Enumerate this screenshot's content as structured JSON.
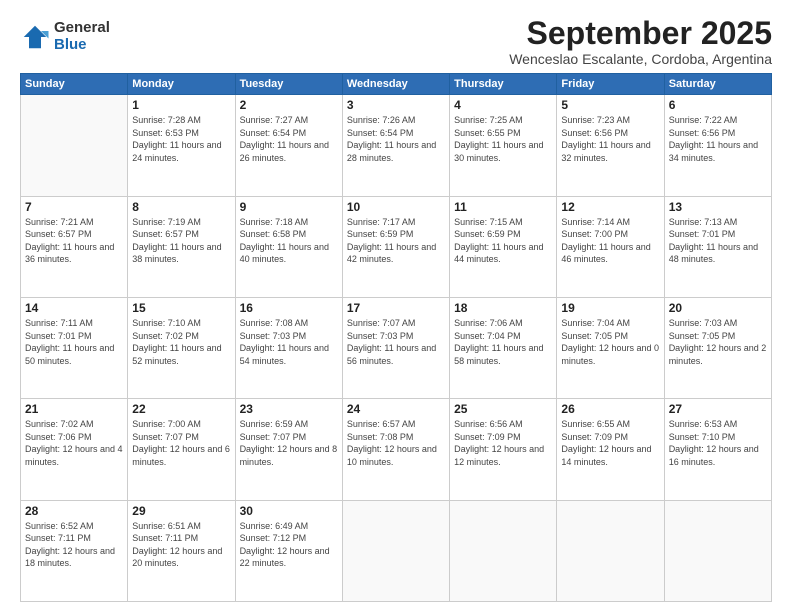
{
  "logo": {
    "general": "General",
    "blue": "Blue"
  },
  "header": {
    "month": "September 2025",
    "location": "Wenceslao Escalante, Cordoba, Argentina"
  },
  "weekdays": [
    "Sunday",
    "Monday",
    "Tuesday",
    "Wednesday",
    "Thursday",
    "Friday",
    "Saturday"
  ],
  "weeks": [
    [
      {
        "day": null,
        "sunrise": null,
        "sunset": null,
        "daylight": null
      },
      {
        "day": "1",
        "sunrise": "7:28 AM",
        "sunset": "6:53 PM",
        "daylight": "11 hours and 24 minutes."
      },
      {
        "day": "2",
        "sunrise": "7:27 AM",
        "sunset": "6:54 PM",
        "daylight": "11 hours and 26 minutes."
      },
      {
        "day": "3",
        "sunrise": "7:26 AM",
        "sunset": "6:54 PM",
        "daylight": "11 hours and 28 minutes."
      },
      {
        "day": "4",
        "sunrise": "7:25 AM",
        "sunset": "6:55 PM",
        "daylight": "11 hours and 30 minutes."
      },
      {
        "day": "5",
        "sunrise": "7:23 AM",
        "sunset": "6:56 PM",
        "daylight": "11 hours and 32 minutes."
      },
      {
        "day": "6",
        "sunrise": "7:22 AM",
        "sunset": "6:56 PM",
        "daylight": "11 hours and 34 minutes."
      }
    ],
    [
      {
        "day": "7",
        "sunrise": "7:21 AM",
        "sunset": "6:57 PM",
        "daylight": "11 hours and 36 minutes."
      },
      {
        "day": "8",
        "sunrise": "7:19 AM",
        "sunset": "6:57 PM",
        "daylight": "11 hours and 38 minutes."
      },
      {
        "day": "9",
        "sunrise": "7:18 AM",
        "sunset": "6:58 PM",
        "daylight": "11 hours and 40 minutes."
      },
      {
        "day": "10",
        "sunrise": "7:17 AM",
        "sunset": "6:59 PM",
        "daylight": "11 hours and 42 minutes."
      },
      {
        "day": "11",
        "sunrise": "7:15 AM",
        "sunset": "6:59 PM",
        "daylight": "11 hours and 44 minutes."
      },
      {
        "day": "12",
        "sunrise": "7:14 AM",
        "sunset": "7:00 PM",
        "daylight": "11 hours and 46 minutes."
      },
      {
        "day": "13",
        "sunrise": "7:13 AM",
        "sunset": "7:01 PM",
        "daylight": "11 hours and 48 minutes."
      }
    ],
    [
      {
        "day": "14",
        "sunrise": "7:11 AM",
        "sunset": "7:01 PM",
        "daylight": "11 hours and 50 minutes."
      },
      {
        "day": "15",
        "sunrise": "7:10 AM",
        "sunset": "7:02 PM",
        "daylight": "11 hours and 52 minutes."
      },
      {
        "day": "16",
        "sunrise": "7:08 AM",
        "sunset": "7:03 PM",
        "daylight": "11 hours and 54 minutes."
      },
      {
        "day": "17",
        "sunrise": "7:07 AM",
        "sunset": "7:03 PM",
        "daylight": "11 hours and 56 minutes."
      },
      {
        "day": "18",
        "sunrise": "7:06 AM",
        "sunset": "7:04 PM",
        "daylight": "11 hours and 58 minutes."
      },
      {
        "day": "19",
        "sunrise": "7:04 AM",
        "sunset": "7:05 PM",
        "daylight": "12 hours and 0 minutes."
      },
      {
        "day": "20",
        "sunrise": "7:03 AM",
        "sunset": "7:05 PM",
        "daylight": "12 hours and 2 minutes."
      }
    ],
    [
      {
        "day": "21",
        "sunrise": "7:02 AM",
        "sunset": "7:06 PM",
        "daylight": "12 hours and 4 minutes."
      },
      {
        "day": "22",
        "sunrise": "7:00 AM",
        "sunset": "7:07 PM",
        "daylight": "12 hours and 6 minutes."
      },
      {
        "day": "23",
        "sunrise": "6:59 AM",
        "sunset": "7:07 PM",
        "daylight": "12 hours and 8 minutes."
      },
      {
        "day": "24",
        "sunrise": "6:57 AM",
        "sunset": "7:08 PM",
        "daylight": "12 hours and 10 minutes."
      },
      {
        "day": "25",
        "sunrise": "6:56 AM",
        "sunset": "7:09 PM",
        "daylight": "12 hours and 12 minutes."
      },
      {
        "day": "26",
        "sunrise": "6:55 AM",
        "sunset": "7:09 PM",
        "daylight": "12 hours and 14 minutes."
      },
      {
        "day": "27",
        "sunrise": "6:53 AM",
        "sunset": "7:10 PM",
        "daylight": "12 hours and 16 minutes."
      }
    ],
    [
      {
        "day": "28",
        "sunrise": "6:52 AM",
        "sunset": "7:11 PM",
        "daylight": "12 hours and 18 minutes."
      },
      {
        "day": "29",
        "sunrise": "6:51 AM",
        "sunset": "7:11 PM",
        "daylight": "12 hours and 20 minutes."
      },
      {
        "day": "30",
        "sunrise": "6:49 AM",
        "sunset": "7:12 PM",
        "daylight": "12 hours and 22 minutes."
      },
      {
        "day": null,
        "sunrise": null,
        "sunset": null,
        "daylight": null
      },
      {
        "day": null,
        "sunrise": null,
        "sunset": null,
        "daylight": null
      },
      {
        "day": null,
        "sunrise": null,
        "sunset": null,
        "daylight": null
      },
      {
        "day": null,
        "sunrise": null,
        "sunset": null,
        "daylight": null
      }
    ]
  ]
}
